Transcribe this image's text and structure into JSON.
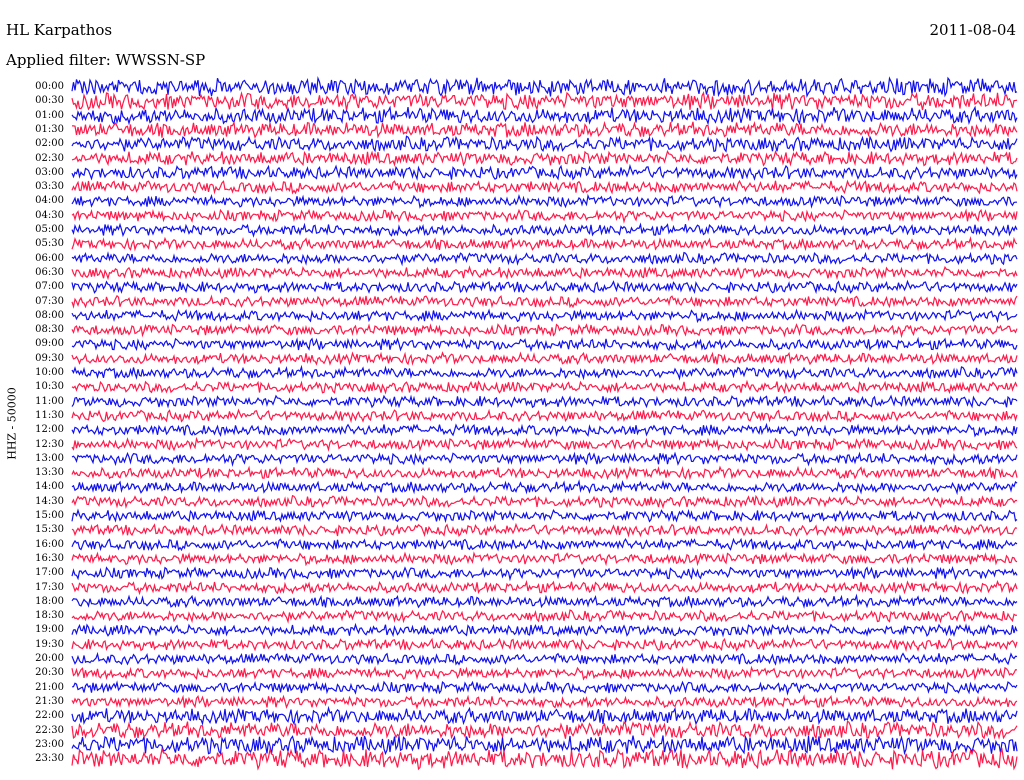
{
  "header": {
    "station": "HL Karpathos",
    "date": "2011-08-04",
    "filter_label": "Applied filter: WWSSN-SP"
  },
  "channel_label": "HHZ - 50000",
  "trace_colors": [
    "#1010ee",
    "#ff1a4a"
  ],
  "time_labels": [
    "00:00",
    "00:30",
    "01:00",
    "01:30",
    "02:00",
    "02:30",
    "03:00",
    "03:30",
    "04:00",
    "04:30",
    "05:00",
    "05:30",
    "06:00",
    "06:30",
    "07:00",
    "07:30",
    "08:00",
    "08:30",
    "09:00",
    "09:30",
    "10:00",
    "10:30",
    "11:00",
    "11:30",
    "12:00",
    "12:30",
    "13:00",
    "13:30",
    "14:00",
    "14:30",
    "15:00",
    "15:30",
    "16:00",
    "16:30",
    "17:00",
    "17:30",
    "18:00",
    "18:30",
    "19:00",
    "19:30",
    "20:00",
    "20:30",
    "21:00",
    "21:30",
    "22:00",
    "22:30",
    "23:00",
    "23:30"
  ]
}
